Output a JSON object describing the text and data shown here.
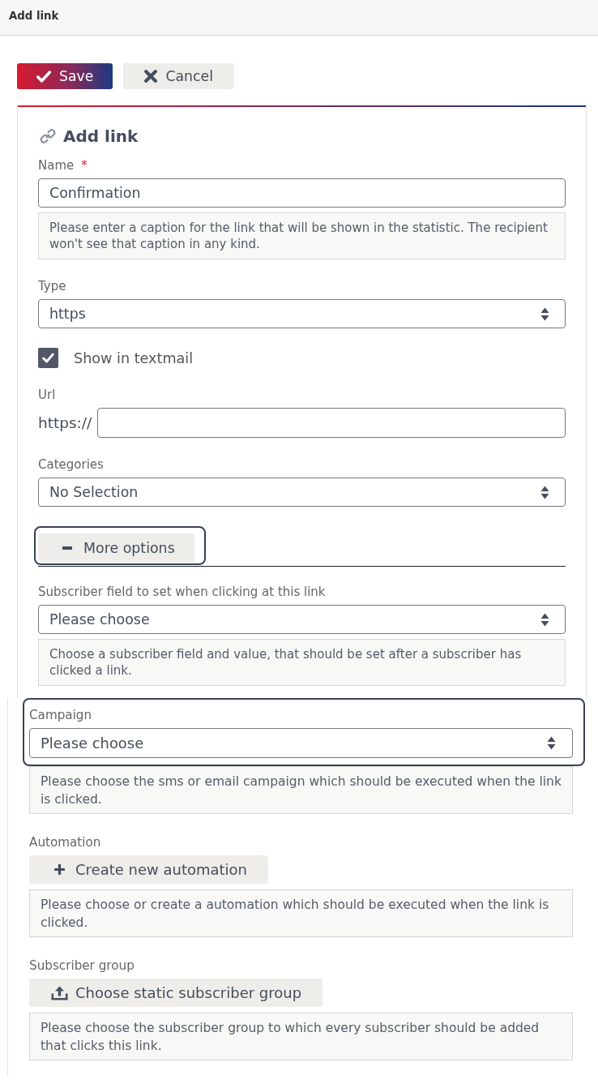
{
  "header": {
    "title": "Add link"
  },
  "toolbar": {
    "buttons": [
      {
        "kind": "save",
        "label": "Save"
      },
      {
        "kind": "cancel",
        "label": "Cancel"
      }
    ]
  },
  "form": {
    "title": "Add link",
    "fields": [
      {
        "kind": "text",
        "label": "Name",
        "required_mark": "*",
        "value": "Confirmation",
        "help": "Please enter a caption for the link that will be shown in the statistic. The recipient won't see that caption in any kind."
      },
      {
        "kind": "select",
        "label": "Type",
        "value": "https"
      },
      {
        "kind": "checkbox",
        "label": "Show in textmail",
        "checked": true
      },
      {
        "kind": "url",
        "label": "Url",
        "prefix": "https://"
      },
      {
        "kind": "select",
        "label": "Categories",
        "value": "No Selection"
      }
    ],
    "more_options": {
      "label": "More options",
      "expanded": true,
      "focused": true
    },
    "more_option_fields": [
      {
        "kind": "select",
        "label": "Subscriber field to set when clicking at this link",
        "value": "Please choose",
        "help": "Choose a subscriber field and value, that should be set after a subscriber has clicked a link."
      }
    ]
  },
  "panel": {
    "fields": [
      {
        "kind": "select",
        "label": "Campaign",
        "value": "Please choose",
        "focused": true,
        "help": "Please choose the sms or email campaign which should be executed when the link is clicked."
      },
      {
        "kind": "action",
        "label": "Automation",
        "button": {
          "kind": "create",
          "label": "Create new automation"
        },
        "focused": false,
        "help": "Please choose or create a automation which should be executed when the link is clicked."
      },
      {
        "kind": "action",
        "label": "Subscriber group",
        "button": {
          "kind": "choose",
          "label": "Choose static subscriber group"
        },
        "focused": false,
        "help": "Please choose the subscriber group to which every subscriber should be added that clicks this link."
      }
    ]
  }
}
